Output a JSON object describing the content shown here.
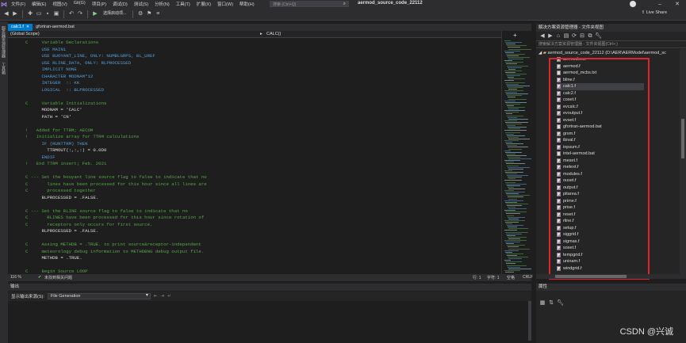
{
  "menu": {
    "items": [
      "文件(F)",
      "编辑(E)",
      "视图(V)",
      "Git(G)",
      "项目(P)",
      "调试(D)",
      "测试(S)",
      "分析(N)",
      "工具(T)",
      "扩展(X)",
      "窗口(W)",
      "帮助(H)"
    ],
    "search_placeholder": "搜索 (Ctrl+Q)",
    "solution_title": "aermod_source_code_22112",
    "live_share": "Live Share"
  },
  "toolbar": {
    "run_target": "选择启动项..."
  },
  "left_strip": {
    "tab1": "服务器资源管理器",
    "tab2": "工具箱"
  },
  "editor": {
    "tabs": [
      {
        "label": "calc1.f",
        "active": true
      },
      {
        "label": "gfortran-aermod.bat",
        "active": false
      }
    ],
    "scope": "(Global Scope)",
    "member": "CALC()",
    "zoom": "116 %",
    "issues": "未找到相关问题",
    "line": "行: 1",
    "char": "字符: 1",
    "spacing": "空格",
    "eol": "CRLF"
  },
  "code_lines": [
    {
      "t": "C     Variable Declarations",
      "c": "c-com"
    },
    {
      "t": "      USE MAIN1",
      "c": "c-kw"
    },
    {
      "t": "      USE BUOYANT_LINE, ONLY: NUMBLGRPS, BL_UREF",
      "c": "c-kw"
    },
    {
      "t": "      USE RLINE_DATA, ONLY: RLPROCESSED",
      "c": "c-kw"
    },
    {
      "t": "      IMPLICIT NONE",
      "c": "c-kw"
    },
    {
      "t": "      CHARACTER MODNAM*12",
      "c": "c-kw"
    },
    {
      "t": "      INTEGER  :: KK",
      "c": "c-kw"
    },
    {
      "t": "      LOGICAL  :: BLPROCESSED",
      "c": "c-kw"
    },
    {
      "t": "",
      "c": "c-txt"
    },
    {
      "t": "C     Variable Initializations",
      "c": "c-com"
    },
    {
      "t": "      MODNAM = 'CALC'",
      "c": "c-txt"
    },
    {
      "t": "      PATH = 'CN'",
      "c": "c-txt"
    },
    {
      "t": "",
      "c": "c-txt"
    },
    {
      "t": "!   Added for TTRM; AECOM",
      "c": "c-com"
    },
    {
      "t": "!   Initialize array for TTRM calculations",
      "c": "c-com"
    },
    {
      "t": "      IF (RUNTTRM) THEN",
      "c": "c-kw"
    },
    {
      "t": "        TTRMOUT(:,:,:) = 0.0D0",
      "c": "c-txt"
    },
    {
      "t": "      ENDIF",
      "c": "c-kw"
    },
    {
      "t": "!   End TTRM insert; Feb. 2021",
      "c": "c-com"
    },
    {
      "t": "",
      "c": "c-txt"
    },
    {
      "t": "C --- Set the bouyant line source flag to false to indicate that no",
      "c": "c-com"
    },
    {
      "t": "C       lines have been processed for this hour since all lines are",
      "c": "c-com"
    },
    {
      "t": "C       processed together",
      "c": "c-com"
    },
    {
      "t": "      BLPROCESSED = .FALSE.",
      "c": "c-txt"
    },
    {
      "t": "",
      "c": "c-txt"
    },
    {
      "t": "C --- Set the RLINE source flag to false to indicate that no",
      "c": "c-com"
    },
    {
      "t": "C       RLINES have been processed for this hour since rotation of",
      "c": "c-com"
    },
    {
      "t": "C       receptors only occurs for first source.",
      "c": "c-com"
    },
    {
      "t": "      RLPROCESSED = .FALSE.",
      "c": "c-txt"
    },
    {
      "t": "",
      "c": "c-txt"
    },
    {
      "t": "C     Assing METHDB = .TRUE. to print source&receptor-independent",
      "c": "c-com"
    },
    {
      "t": "C     meteorology debug information to METHDBNG debug output file.",
      "c": "c-com"
    },
    {
      "t": "      METHDB = .TRUE.",
      "c": "c-txt"
    },
    {
      "t": "",
      "c": "c-txt"
    },
    {
      "t": "C     Begin Source LOOP",
      "c": "c-com"
    }
  ],
  "output": {
    "title": "输出",
    "show_from_label": "显示输出来源(S):",
    "show_from_value": "File Generation"
  },
  "solution_explorer": {
    "title": "解决方案资源管理器 - 文件夹视图",
    "search_placeholder": "搜索解决方案资源管理器 - 文件夹视图(Ctrl+;)",
    "root": "aermod_source_code_22112 (D:\\AER\\AERModel\\aermod_sc",
    "files": [
      {
        "name": "aermod.exe",
        "type": "f"
      },
      {
        "name": "aermod.f",
        "type": "f"
      },
      {
        "name": "aermod_mcbs.txt",
        "type": "txt"
      },
      {
        "name": "bline.f",
        "type": "f"
      },
      {
        "name": "calc1.f",
        "type": "f",
        "selected": true
      },
      {
        "name": "calc2.f",
        "type": "f"
      },
      {
        "name": "coset.f",
        "type": "f"
      },
      {
        "name": "evcalc.f",
        "type": "f"
      },
      {
        "name": "evoutput.f",
        "type": "f"
      },
      {
        "name": "evset.f",
        "type": "f"
      },
      {
        "name": "gfortran-aermod.bat",
        "type": "bat"
      },
      {
        "name": "grsm.f",
        "type": "f"
      },
      {
        "name": "ibival.f",
        "type": "f"
      },
      {
        "name": "inpsum.f",
        "type": "f"
      },
      {
        "name": "intel-aermod.bat",
        "type": "bat"
      },
      {
        "name": "meset.f",
        "type": "f"
      },
      {
        "name": "metext.f",
        "type": "f"
      },
      {
        "name": "modules.f",
        "type": "f"
      },
      {
        "name": "ouset.f",
        "type": "f"
      },
      {
        "name": "output.f",
        "type": "f"
      },
      {
        "name": "pitarea.f",
        "type": "f"
      },
      {
        "name": "prime.f",
        "type": "f"
      },
      {
        "name": "prise.f",
        "type": "f"
      },
      {
        "name": "reset.f",
        "type": "f"
      },
      {
        "name": "rline.f",
        "type": "f"
      },
      {
        "name": "setup.f",
        "type": "f"
      },
      {
        "name": "siggrid.f",
        "type": "f"
      },
      {
        "name": "sigmas.f",
        "type": "f"
      },
      {
        "name": "soset.f",
        "type": "f"
      },
      {
        "name": "tempgrid.f",
        "type": "f"
      },
      {
        "name": "uninam.f",
        "type": "f"
      },
      {
        "name": "windgrid.f",
        "type": "f"
      }
    ]
  },
  "properties": {
    "title": "属性"
  },
  "watermark": "CSDN @兴诚"
}
